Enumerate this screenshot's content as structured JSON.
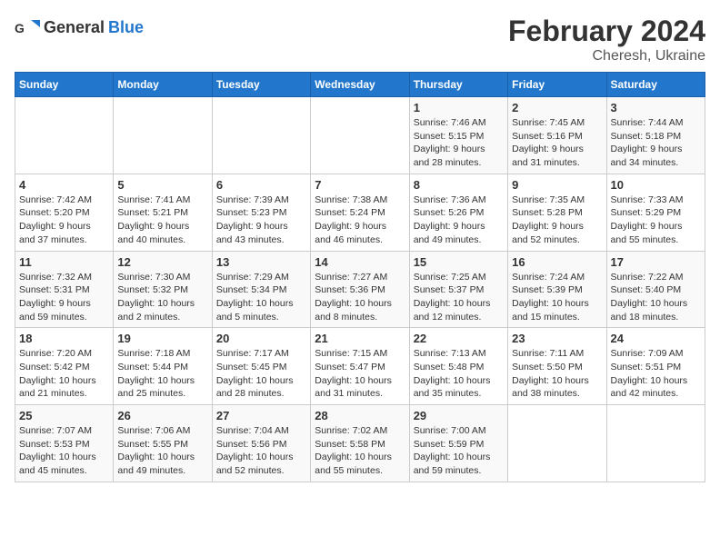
{
  "header": {
    "logo_general": "General",
    "logo_blue": "Blue",
    "title": "February 2024",
    "subtitle": "Cheresh, Ukraine"
  },
  "days_of_week": [
    "Sunday",
    "Monday",
    "Tuesday",
    "Wednesday",
    "Thursday",
    "Friday",
    "Saturday"
  ],
  "weeks": [
    [
      {
        "day": "",
        "info": ""
      },
      {
        "day": "",
        "info": ""
      },
      {
        "day": "",
        "info": ""
      },
      {
        "day": "",
        "info": ""
      },
      {
        "day": "1",
        "info": "Sunrise: 7:46 AM\nSunset: 5:15 PM\nDaylight: 9 hours\nand 28 minutes."
      },
      {
        "day": "2",
        "info": "Sunrise: 7:45 AM\nSunset: 5:16 PM\nDaylight: 9 hours\nand 31 minutes."
      },
      {
        "day": "3",
        "info": "Sunrise: 7:44 AM\nSunset: 5:18 PM\nDaylight: 9 hours\nand 34 minutes."
      }
    ],
    [
      {
        "day": "4",
        "info": "Sunrise: 7:42 AM\nSunset: 5:20 PM\nDaylight: 9 hours\nand 37 minutes."
      },
      {
        "day": "5",
        "info": "Sunrise: 7:41 AM\nSunset: 5:21 PM\nDaylight: 9 hours\nand 40 minutes."
      },
      {
        "day": "6",
        "info": "Sunrise: 7:39 AM\nSunset: 5:23 PM\nDaylight: 9 hours\nand 43 minutes."
      },
      {
        "day": "7",
        "info": "Sunrise: 7:38 AM\nSunset: 5:24 PM\nDaylight: 9 hours\nand 46 minutes."
      },
      {
        "day": "8",
        "info": "Sunrise: 7:36 AM\nSunset: 5:26 PM\nDaylight: 9 hours\nand 49 minutes."
      },
      {
        "day": "9",
        "info": "Sunrise: 7:35 AM\nSunset: 5:28 PM\nDaylight: 9 hours\nand 52 minutes."
      },
      {
        "day": "10",
        "info": "Sunrise: 7:33 AM\nSunset: 5:29 PM\nDaylight: 9 hours\nand 55 minutes."
      }
    ],
    [
      {
        "day": "11",
        "info": "Sunrise: 7:32 AM\nSunset: 5:31 PM\nDaylight: 9 hours\nand 59 minutes."
      },
      {
        "day": "12",
        "info": "Sunrise: 7:30 AM\nSunset: 5:32 PM\nDaylight: 10 hours\nand 2 minutes."
      },
      {
        "day": "13",
        "info": "Sunrise: 7:29 AM\nSunset: 5:34 PM\nDaylight: 10 hours\nand 5 minutes."
      },
      {
        "day": "14",
        "info": "Sunrise: 7:27 AM\nSunset: 5:36 PM\nDaylight: 10 hours\nand 8 minutes."
      },
      {
        "day": "15",
        "info": "Sunrise: 7:25 AM\nSunset: 5:37 PM\nDaylight: 10 hours\nand 12 minutes."
      },
      {
        "day": "16",
        "info": "Sunrise: 7:24 AM\nSunset: 5:39 PM\nDaylight: 10 hours\nand 15 minutes."
      },
      {
        "day": "17",
        "info": "Sunrise: 7:22 AM\nSunset: 5:40 PM\nDaylight: 10 hours\nand 18 minutes."
      }
    ],
    [
      {
        "day": "18",
        "info": "Sunrise: 7:20 AM\nSunset: 5:42 PM\nDaylight: 10 hours\nand 21 minutes."
      },
      {
        "day": "19",
        "info": "Sunrise: 7:18 AM\nSunset: 5:44 PM\nDaylight: 10 hours\nand 25 minutes."
      },
      {
        "day": "20",
        "info": "Sunrise: 7:17 AM\nSunset: 5:45 PM\nDaylight: 10 hours\nand 28 minutes."
      },
      {
        "day": "21",
        "info": "Sunrise: 7:15 AM\nSunset: 5:47 PM\nDaylight: 10 hours\nand 31 minutes."
      },
      {
        "day": "22",
        "info": "Sunrise: 7:13 AM\nSunset: 5:48 PM\nDaylight: 10 hours\nand 35 minutes."
      },
      {
        "day": "23",
        "info": "Sunrise: 7:11 AM\nSunset: 5:50 PM\nDaylight: 10 hours\nand 38 minutes."
      },
      {
        "day": "24",
        "info": "Sunrise: 7:09 AM\nSunset: 5:51 PM\nDaylight: 10 hours\nand 42 minutes."
      }
    ],
    [
      {
        "day": "25",
        "info": "Sunrise: 7:07 AM\nSunset: 5:53 PM\nDaylight: 10 hours\nand 45 minutes."
      },
      {
        "day": "26",
        "info": "Sunrise: 7:06 AM\nSunset: 5:55 PM\nDaylight: 10 hours\nand 49 minutes."
      },
      {
        "day": "27",
        "info": "Sunrise: 7:04 AM\nSunset: 5:56 PM\nDaylight: 10 hours\nand 52 minutes."
      },
      {
        "day": "28",
        "info": "Sunrise: 7:02 AM\nSunset: 5:58 PM\nDaylight: 10 hours\nand 55 minutes."
      },
      {
        "day": "29",
        "info": "Sunrise: 7:00 AM\nSunset: 5:59 PM\nDaylight: 10 hours\nand 59 minutes."
      },
      {
        "day": "",
        "info": ""
      },
      {
        "day": "",
        "info": ""
      }
    ]
  ]
}
